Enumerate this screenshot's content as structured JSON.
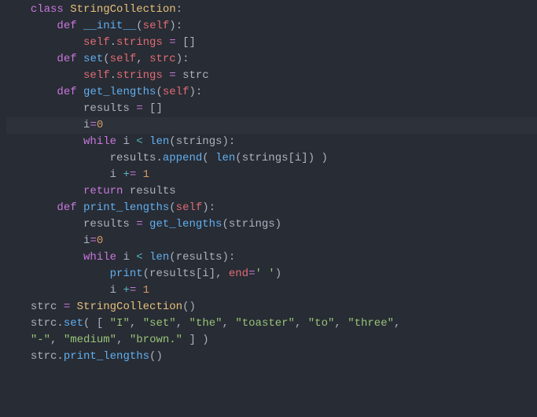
{
  "language": "python",
  "highlighted_line_index": 7,
  "code": {
    "class_name": "StringCollection",
    "methods": {
      "init": "__init__",
      "set": "set",
      "get_lengths": "get_lengths",
      "print_lengths": "print_lengths"
    },
    "identifiers": {
      "self": "self",
      "strings": "strings",
      "strc_param": "strc",
      "results": "results",
      "i": "i",
      "len": "len",
      "append": "append",
      "print": "print",
      "end_kw": "end",
      "strc_var": "strc"
    },
    "keywords": {
      "class": "class",
      "def": "def",
      "while": "while",
      "return": "return"
    },
    "literals": {
      "empty_list": "[]",
      "zero": "0",
      "one": "1",
      "space_str": "' '",
      "list_items": [
        "\"I\"",
        "\"set\"",
        "\"the\"",
        "\"toaster\"",
        "\"to\"",
        "\"three\"",
        "\"-\"",
        "\"medium\"",
        "\"brown.\""
      ]
    }
  },
  "tokens": [
    [
      [
        "kw",
        "class"
      ],
      [
        "pun",
        " "
      ],
      [
        "name",
        "StringCollection"
      ],
      [
        "pun",
        ":"
      ]
    ],
    [
      [
        "pun",
        "    "
      ],
      [
        "kw",
        "def"
      ],
      [
        "pun",
        " "
      ],
      [
        "fn",
        "__init__"
      ],
      [
        "pun",
        "("
      ],
      [
        "self",
        "self"
      ],
      [
        "pun",
        "):"
      ]
    ],
    [
      [
        "pun",
        "        "
      ],
      [
        "self",
        "self"
      ],
      [
        "pun",
        "."
      ],
      [
        "self",
        "strings"
      ],
      [
        "pun",
        " "
      ],
      [
        "eq",
        "="
      ],
      [
        "pun",
        " "
      ],
      [
        "pun",
        "[]"
      ]
    ],
    [
      [
        "pun",
        "    "
      ],
      [
        "kw",
        "def"
      ],
      [
        "pun",
        " "
      ],
      [
        "fn",
        "set"
      ],
      [
        "pun",
        "("
      ],
      [
        "self",
        "self"
      ],
      [
        "pun",
        ", "
      ],
      [
        "self",
        "strc"
      ],
      [
        "pun",
        "):"
      ]
    ],
    [
      [
        "pun",
        "        "
      ],
      [
        "self",
        "self"
      ],
      [
        "pun",
        "."
      ],
      [
        "self",
        "strings"
      ],
      [
        "pun",
        " "
      ],
      [
        "eq",
        "="
      ],
      [
        "pun",
        " strc"
      ]
    ],
    [
      [
        "pun",
        "    "
      ],
      [
        "kw",
        "def"
      ],
      [
        "pun",
        " "
      ],
      [
        "fn",
        "get_lengths"
      ],
      [
        "pun",
        "("
      ],
      [
        "self",
        "self"
      ],
      [
        "pun",
        "):"
      ]
    ],
    [
      [
        "pun",
        "        results "
      ],
      [
        "eq",
        "="
      ],
      [
        "pun",
        " []"
      ]
    ],
    [
      [
        "pun",
        "        i"
      ],
      [
        "eq",
        "="
      ],
      [
        "num",
        "0"
      ]
    ],
    [
      [
        "pun",
        "        "
      ],
      [
        "kw",
        "while"
      ],
      [
        "pun",
        " i "
      ],
      [
        "op",
        "<"
      ],
      [
        "pun",
        " "
      ],
      [
        "fn",
        "len"
      ],
      [
        "pun",
        "(strings):"
      ]
    ],
    [
      [
        "pun",
        "            results."
      ],
      [
        "fn",
        "append"
      ],
      [
        "pun",
        "( "
      ],
      [
        "fn",
        "len"
      ],
      [
        "pun",
        "(strings[i]) )"
      ]
    ],
    [
      [
        "pun",
        "            i "
      ],
      [
        "op",
        "+"
      ],
      [
        "eq",
        "="
      ],
      [
        "pun",
        " "
      ],
      [
        "num",
        "1"
      ]
    ],
    [
      [
        "pun",
        "        "
      ],
      [
        "kw",
        "return"
      ],
      [
        "pun",
        " results"
      ]
    ],
    [
      [
        "pun",
        "    "
      ],
      [
        "kw",
        "def"
      ],
      [
        "pun",
        " "
      ],
      [
        "fn",
        "print_lengths"
      ],
      [
        "pun",
        "("
      ],
      [
        "self",
        "self"
      ],
      [
        "pun",
        "):"
      ]
    ],
    [
      [
        "pun",
        "        results "
      ],
      [
        "eq",
        "="
      ],
      [
        "pun",
        " "
      ],
      [
        "fn",
        "get_lengths"
      ],
      [
        "pun",
        "(strings)"
      ]
    ],
    [
      [
        "pun",
        "        i"
      ],
      [
        "eq",
        "="
      ],
      [
        "num",
        "0"
      ]
    ],
    [
      [
        "pun",
        "        "
      ],
      [
        "kw",
        "while"
      ],
      [
        "pun",
        " i "
      ],
      [
        "op",
        "<"
      ],
      [
        "pun",
        " "
      ],
      [
        "fn",
        "len"
      ],
      [
        "pun",
        "(results):"
      ]
    ],
    [
      [
        "pun",
        "            "
      ],
      [
        "fn",
        "print"
      ],
      [
        "pun",
        "(results[i], "
      ],
      [
        "self",
        "end"
      ],
      [
        "eq",
        "="
      ],
      [
        "str",
        "' '"
      ],
      [
        "pun",
        ")"
      ]
    ],
    [
      [
        "pun",
        "            i "
      ],
      [
        "op",
        "+"
      ],
      [
        "eq",
        "="
      ],
      [
        "pun",
        " "
      ],
      [
        "num",
        "1"
      ]
    ],
    [
      [
        "pun",
        "strc "
      ],
      [
        "eq",
        "="
      ],
      [
        "pun",
        " "
      ],
      [
        "name",
        "StringCollection"
      ],
      [
        "pun",
        "()"
      ]
    ],
    [
      [
        "pun",
        "strc."
      ],
      [
        "fn",
        "set"
      ],
      [
        "pun",
        "( [ "
      ],
      [
        "str",
        "\"I\""
      ],
      [
        "pun",
        ", "
      ],
      [
        "str",
        "\"set\""
      ],
      [
        "pun",
        ", "
      ],
      [
        "str",
        "\"the\""
      ],
      [
        "pun",
        ", "
      ],
      [
        "str",
        "\"toaster\""
      ],
      [
        "pun",
        ", "
      ],
      [
        "str",
        "\"to\""
      ],
      [
        "pun",
        ", "
      ],
      [
        "str",
        "\"three\""
      ],
      [
        "pun",
        ","
      ]
    ],
    [
      [
        "str",
        "\"-\""
      ],
      [
        "pun",
        ", "
      ],
      [
        "str",
        "\"medium\""
      ],
      [
        "pun",
        ", "
      ],
      [
        "str",
        "\"brown.\""
      ],
      [
        "pun",
        " ] )"
      ]
    ],
    [
      [
        "pun",
        "strc."
      ],
      [
        "fn",
        "print_lengths"
      ],
      [
        "pun",
        "()"
      ]
    ]
  ]
}
